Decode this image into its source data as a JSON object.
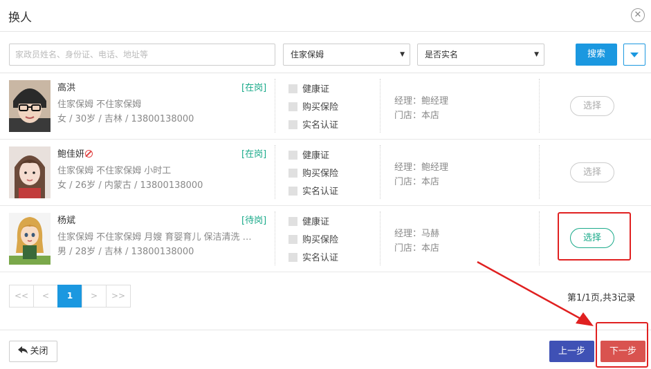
{
  "dialog": {
    "title": "换人"
  },
  "toolbar": {
    "search_placeholder": "家政员姓名、身份证、电话、地址等",
    "type_select_value": "住家保姆",
    "real_name_select_value": "是否实名",
    "search_label": "搜索"
  },
  "workers": [
    {
      "name": "高洪",
      "status": "[在岗]",
      "services": "住家保姆 不住家保姆",
      "info": "女 / 30岁 / 吉林 / 13800138000",
      "certs": [
        "健康证",
        "购买保险",
        "实名认证"
      ],
      "manager": "经理：鲍经理",
      "store": "门店：本店",
      "choose_label": "选择"
    },
    {
      "name": "鲍佳妍",
      "status": "[在岗]",
      "services": "住家保姆 不住家保姆 小时工",
      "info": "女 / 26岁 / 内蒙古 / 13800138000",
      "certs": [
        "健康证",
        "购买保险",
        "实名认证"
      ],
      "manager": "经理：鲍经理",
      "store": "门店：本店",
      "choose_label": "选择"
    },
    {
      "name": "杨斌",
      "status": "[待岗]",
      "services": "住家保姆 不住家保姆 月嫂 育婴育儿 保洁清洗 …",
      "info": "男 / 28岁 / 吉林 / 13800138000",
      "certs": [
        "健康证",
        "购买保险",
        "实名认证"
      ],
      "manager": "经理：马赫",
      "store": "门店：本店",
      "choose_label": "选择"
    }
  ],
  "pagination": {
    "first": "<<",
    "prev": "<",
    "current": "1",
    "next": ">",
    "last": ">>",
    "summary": "第1/1页,共3记录"
  },
  "footer": {
    "close_label": "关闭",
    "prev_step_label": "上一步",
    "next_step_label": "下一步"
  },
  "colors": {
    "primary": "#1b98e0",
    "status_green": "#1aaa8a",
    "prev_button": "#3f51b5",
    "next_button": "#d9534f",
    "annotation_red": "#e02020"
  }
}
